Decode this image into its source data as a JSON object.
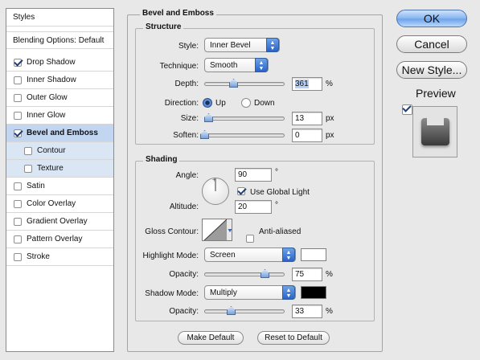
{
  "styles_panel": {
    "header": "Styles",
    "blending": "Blending Options: Default",
    "items": [
      {
        "label": "Drop Shadow",
        "checked": true
      },
      {
        "label": "Inner Shadow",
        "checked": false
      },
      {
        "label": "Outer Glow",
        "checked": false
      },
      {
        "label": "Inner Glow",
        "checked": false
      },
      {
        "label": "Bevel and Emboss",
        "checked": true,
        "selected": true
      },
      {
        "label": "Contour",
        "checked": false,
        "sub": true
      },
      {
        "label": "Texture",
        "checked": false,
        "sub": true
      },
      {
        "label": "Satin",
        "checked": false
      },
      {
        "label": "Color Overlay",
        "checked": false
      },
      {
        "label": "Gradient Overlay",
        "checked": false
      },
      {
        "label": "Pattern Overlay",
        "checked": false
      },
      {
        "label": "Stroke",
        "checked": false
      }
    ]
  },
  "panel": {
    "title": "Bevel and Emboss",
    "structure": {
      "title": "Structure",
      "style_label": "Style:",
      "style_value": "Inner Bevel",
      "technique_label": "Technique:",
      "technique_value": "Smooth",
      "depth_label": "Depth:",
      "depth_value": "361",
      "depth_unit": "%",
      "depth_slider_fraction": 0.36,
      "direction_label": "Direction:",
      "direction_up": "Up",
      "direction_down": "Down",
      "direction_selected": "Up",
      "size_label": "Size:",
      "size_value": "13",
      "size_unit": "px",
      "size_slider_fraction": 0.05,
      "soften_label": "Soften:",
      "soften_value": "0",
      "soften_unit": "px",
      "soften_slider_fraction": 0.0
    },
    "shading": {
      "title": "Shading",
      "angle_label": "Angle:",
      "angle_value": "90",
      "angle_unit": "°",
      "use_global_light": "Use Global Light",
      "use_global_light_checked": true,
      "altitude_label": "Altitude:",
      "altitude_value": "20",
      "altitude_unit": "°",
      "gloss_contour_label": "Gloss Contour:",
      "anti_aliased": "Anti-aliased",
      "anti_aliased_checked": false,
      "highlight_mode_label": "Highlight Mode:",
      "highlight_mode_value": "Screen",
      "highlight_color": "#ffffff",
      "highlight_opacity_label": "Opacity:",
      "highlight_opacity_value": "75",
      "highlight_opacity_unit": "%",
      "highlight_opacity_fraction": 0.75,
      "shadow_mode_label": "Shadow Mode:",
      "shadow_mode_value": "Multiply",
      "shadow_color": "#000000",
      "shadow_opacity_label": "Opacity:",
      "shadow_opacity_value": "33",
      "shadow_opacity_unit": "%",
      "shadow_opacity_fraction": 0.33
    },
    "make_default": "Make Default",
    "reset_default": "Reset to Default"
  },
  "actions": {
    "ok": "OK",
    "cancel": "Cancel",
    "new_style": "New Style...",
    "preview": "Preview",
    "preview_checked": true
  },
  "icons": {
    "checkbox": "checkmark-icon",
    "popup_arrows": "updown-arrows-icon",
    "slider_thumb": "slider-thumb-icon",
    "angle": "angle-wheel-icon",
    "contour": "gloss-contour-icon",
    "preview": "preview-thumbnail-icon"
  },
  "colors": {
    "selection": "#c3d6f1",
    "accent": "#2a63c8"
  }
}
